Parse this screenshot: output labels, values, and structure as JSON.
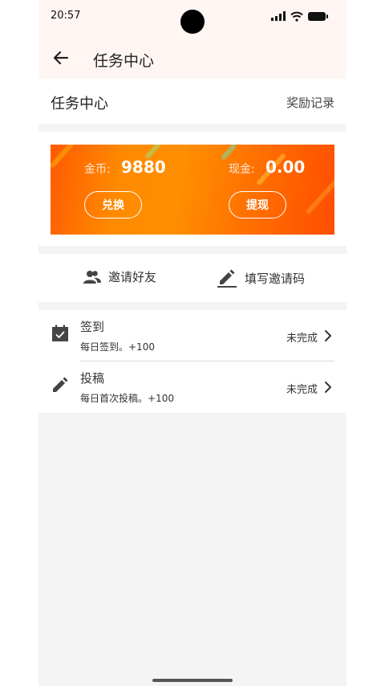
{
  "status_bar": {
    "time": "20:57"
  },
  "header": {
    "title": "任务中心"
  },
  "section": {
    "title": "任务中心",
    "reward_link": "奖励记录"
  },
  "wallet": {
    "coin_label": "金币:",
    "coin_value": "9880",
    "cash_label": "现金:",
    "cash_value": "0.00",
    "exchange_button": "兑换",
    "withdraw_button": "提现"
  },
  "invite": {
    "invite_friends": "邀请好友",
    "enter_code": "填写邀请码"
  },
  "tasks": [
    {
      "name": "签到",
      "desc": "每日签到。+100",
      "status": "未完成",
      "icon": "calendar-check-icon"
    },
    {
      "name": "投稿",
      "desc": "每日首次投稿。+100",
      "status": "未完成",
      "icon": "pencil-icon"
    }
  ],
  "colors": {
    "accent": "#ff7a00",
    "topbar_bg": "#fff6f3",
    "page_bg": "#f4f4f4"
  }
}
